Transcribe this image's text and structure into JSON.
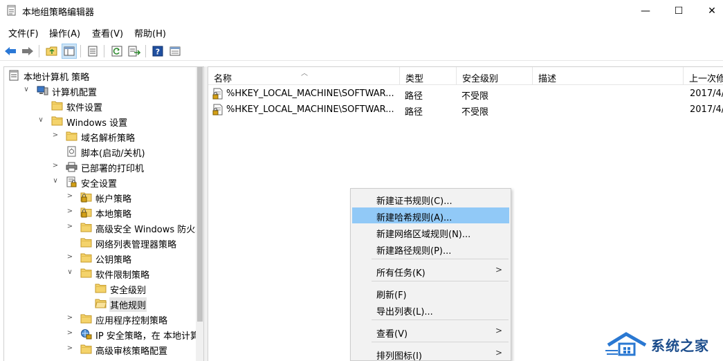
{
  "window": {
    "title": "本地组策略编辑器",
    "minimize": "—",
    "maximize": "☐",
    "close": "✕"
  },
  "menubar": {
    "items": [
      "文件(F)",
      "操作(A)",
      "查看(V)",
      "帮助(H)"
    ]
  },
  "toolbar": {
    "icons": [
      "back-arrow-icon",
      "forward-arrow-icon",
      "up-folder-icon",
      "show-tree-icon",
      "properties-icon",
      "refresh-icon",
      "export-list-icon",
      "help-icon",
      "view-icon"
    ]
  },
  "tree": {
    "items": [
      {
        "label": "本地计算机 策略",
        "icon": "computer-policy-icon",
        "expander": ""
      },
      {
        "label": "计算机配置",
        "icon": "computer-icon",
        "expander": "∨"
      },
      {
        "label": "软件设置",
        "icon": "folder-icon",
        "expander": ""
      },
      {
        "label": "Windows 设置",
        "icon": "folder-icon",
        "expander": "∨"
      },
      {
        "label": "域名解析策略",
        "icon": "folder-icon",
        "expander": ">"
      },
      {
        "label": "脚本(启动/关机)",
        "icon": "script-icon",
        "expander": ""
      },
      {
        "label": "已部署的打印机",
        "icon": "printer-icon",
        "expander": ">"
      },
      {
        "label": "安全设置",
        "icon": "security-settings-icon",
        "expander": "∨"
      },
      {
        "label": "帐户策略",
        "icon": "locked-folder-icon",
        "expander": ">"
      },
      {
        "label": "本地策略",
        "icon": "locked-folder-icon",
        "expander": ">"
      },
      {
        "label": "高级安全 Windows 防火墙",
        "icon": "folder-icon",
        "expander": ">"
      },
      {
        "label": "网络列表管理器策略",
        "icon": "folder-icon",
        "expander": ""
      },
      {
        "label": "公钥策略",
        "icon": "folder-icon",
        "expander": ">"
      },
      {
        "label": "软件限制策略",
        "icon": "folder-icon",
        "expander": "∨"
      },
      {
        "label": "安全级别",
        "icon": "folder-icon",
        "expander": ""
      },
      {
        "label": "其他规则",
        "icon": "folder-open-icon",
        "expander": ""
      },
      {
        "label": "应用程序控制策略",
        "icon": "folder-icon",
        "expander": ">"
      },
      {
        "label": "IP 安全策略，在 本地计算机",
        "icon": "ip-security-icon",
        "expander": ">"
      },
      {
        "label": "高级审核策略配置",
        "icon": "folder-icon",
        "expander": ">"
      }
    ]
  },
  "list": {
    "columns": [
      "名称",
      "类型",
      "安全级别",
      "描述",
      "上一次修"
    ],
    "rows": [
      {
        "name": "%HKEY_LOCAL_MACHINE\\SOFTWAR...",
        "type": "路径",
        "level": "不受限",
        "desc": "",
        "modified": "2017/4/"
      },
      {
        "name": "%HKEY_LOCAL_MACHINE\\SOFTWAR...",
        "type": "路径",
        "level": "不受限",
        "desc": "",
        "modified": "2017/4/"
      }
    ]
  },
  "context_menu": {
    "items": [
      {
        "label": "新建证书规则(C)...",
        "submenu": ""
      },
      {
        "label": "新建哈希规则(A)...",
        "submenu": ""
      },
      {
        "label": "新建网络区域规则(N)...",
        "submenu": ""
      },
      {
        "label": "新建路径规则(P)...",
        "submenu": ""
      },
      {
        "label": "所有任务(K)",
        "submenu": ">"
      },
      {
        "label": "刷新(F)",
        "submenu": ""
      },
      {
        "label": "导出列表(L)...",
        "submenu": ""
      },
      {
        "label": "查看(V)",
        "submenu": ">"
      },
      {
        "label": "排列图标(I)",
        "submenu": ">"
      }
    ]
  },
  "watermark": {
    "text": "系统之家"
  },
  "colors": {
    "hover": "#91c9f7",
    "folder": "#f4d36b",
    "selected": "#e5e5e5"
  }
}
